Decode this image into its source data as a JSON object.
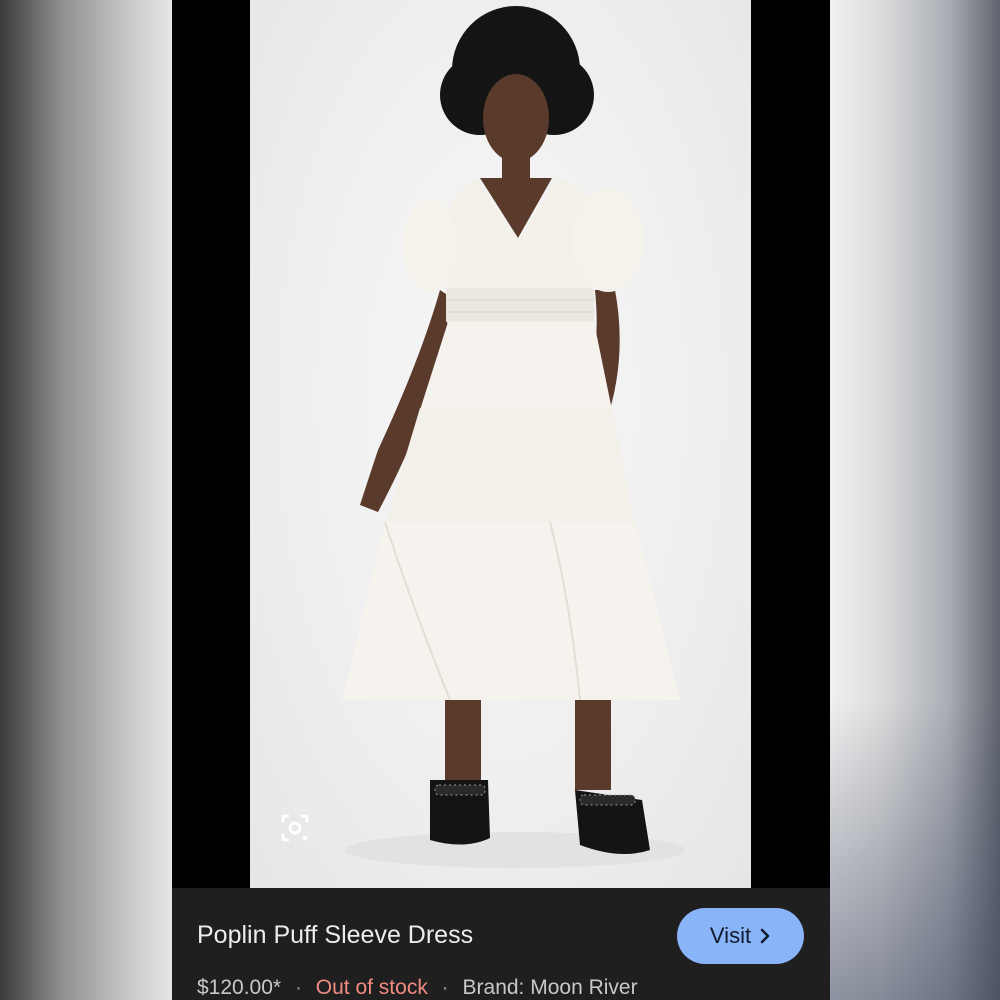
{
  "product": {
    "title": "Poplin Puff Sleeve Dress",
    "price": "$120.00*",
    "separator": "·",
    "stock_status": "Out of stock",
    "brand": "Brand: Moon River"
  },
  "actions": {
    "visit_label": "Visit",
    "visit_icon": "chevron-right-icon",
    "lens_icon": "lens-search-icon"
  },
  "colors": {
    "visit_bg": "#8ab4f8",
    "stock_red": "#f28b82",
    "panel_bg": "#1f1f1f"
  }
}
